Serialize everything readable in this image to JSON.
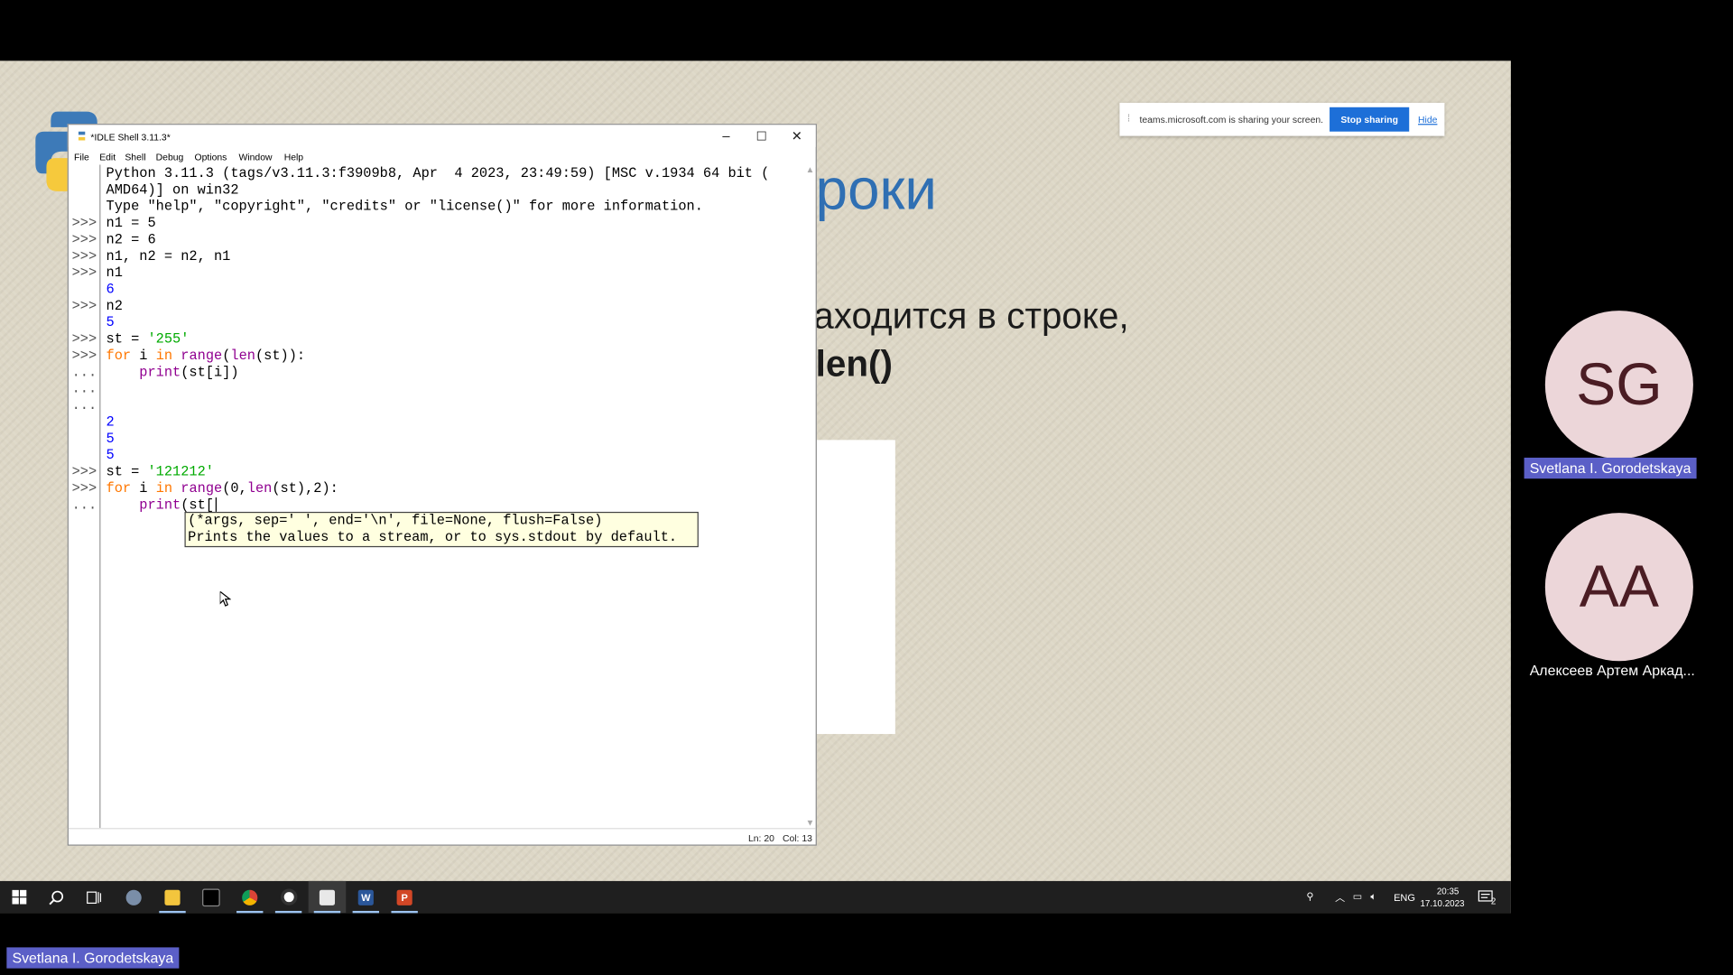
{
  "slide": {
    "title_fragment": "роки",
    "text_line1": "аходится в строке,",
    "text_line2": "len()"
  },
  "share_banner": {
    "message": "teams.microsoft.com is sharing your screen.",
    "stop_label": "Stop sharing",
    "hide_label": "Hide"
  },
  "idle": {
    "title": "*IDLE Shell 3.11.3*",
    "menu": [
      "File",
      "Edit",
      "Shell",
      "Debug",
      "Options",
      "Window",
      "Help"
    ],
    "minimize": "–",
    "maximize": "☐",
    "close": "✕",
    "prompts": [
      ">>>",
      ">>>",
      ">>>",
      ">>>",
      ">>>",
      ">>>",
      ">>>",
      "...",
      "...",
      "...",
      ">>>",
      ">>>",
      "..."
    ],
    "banner1": "Python 3.11.3 (tags/v3.11.3:f3909b8, Apr  4 2023, 23:49:59) [MSC v.1934 64 bit (",
    "banner2": "AMD64)] on win32",
    "banner3": "Type \"help\", \"copyright\", \"credits\" or \"license()\" for more information.",
    "code": {
      "l1": "n1 = 5",
      "l2": "n2 = 6",
      "l3": "n1, n2 = n2, n1",
      "l4": "n1",
      "o1": "6",
      "l5": "n2",
      "o2": "5",
      "l6a": "st = ",
      "l6b": "'255'",
      "l7_for": "for",
      "l7_i": " i ",
      "l7_in": "in",
      "l7_range": "range",
      "l7_p1": "(",
      "l7_len": "len",
      "l7_rest": "(st)):",
      "l8_indent": "    ",
      "l8_print": "print",
      "l8_rest": "(st[i])",
      "o3": "2",
      "o4": "5",
      "o5": "5",
      "l9a": "st = ",
      "l9b": "'121212'",
      "l10_for": "for",
      "l10_i": " i ",
      "l10_in": "in",
      "l10_range": "range",
      "l10_p1": "(0,",
      "l10_len": "len",
      "l10_rest": "(st),2):",
      "l11_indent": "    ",
      "l11_print": "print",
      "l11_rest": "(st["
    },
    "calltip_line1": "(*args, sep=' ', end='\\n', file=None, flush=False)",
    "calltip_line2": "Prints the values to a stream, or to sys.stdout by default.",
    "status_ln": "Ln: 20",
    "status_col": "Col: 13"
  },
  "taskbar": {
    "lang": "ENG",
    "time": "20:35",
    "date": "17.10.2023",
    "notif_count": "2"
  },
  "participants": [
    {
      "initials": "SG",
      "name": "Svetlana I. Gorodetskaya"
    },
    {
      "initials": "AA",
      "name": "Алексеев Артем Аркад..."
    }
  ],
  "presenter_tag": "Svetlana I. Gorodetskaya",
  "colors": {
    "teams_purple": "#5b5fc7",
    "idle_keyword": "#ff7700",
    "idle_builtin": "#900090",
    "idle_string": "#00aa00",
    "idle_output": "#0000ff",
    "calltip_bg": "#ffffe0"
  }
}
